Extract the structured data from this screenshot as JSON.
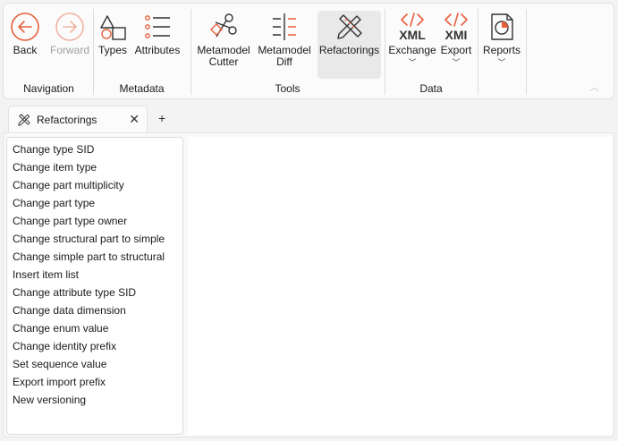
{
  "ribbon": {
    "navigation": {
      "label": "Navigation",
      "back": "Back",
      "forward": "Forward"
    },
    "metadata": {
      "label": "Metadata",
      "types": "Types",
      "attributes": "Attributes"
    },
    "tools": {
      "label": "Tools",
      "metamodel_cutter_1": "Metamodel",
      "metamodel_cutter_2": "Cutter",
      "metamodel_diff_1": "Metamodel",
      "metamodel_diff_2": "Diff",
      "refactorings": "Refactorings"
    },
    "data": {
      "label": "Data",
      "xml_text": "XML",
      "exchange": "Exchange",
      "xmi_text": "XMI",
      "export": "Export"
    },
    "reports": {
      "label": "Reports"
    }
  },
  "tab": {
    "title": "Refactorings",
    "close": "✕",
    "add": "+"
  },
  "refactorings": [
    "Change type SID",
    "Change item type",
    "Change part multiplicity",
    "Change part type",
    "Change part type owner",
    "Change structural part to simple",
    "Change simple part to structural",
    "Insert item list",
    "Change attribute type SID",
    "Change data dimension",
    "Change enum value",
    "Change identity prefix",
    "Set sequence value",
    "Export import prefix",
    "New versioning"
  ],
  "colors": {
    "accent": "#e8603c",
    "text": "#1b1b1b",
    "disabled": "#a0a0a0"
  },
  "icons": {
    "back": "arrow-left-circle-icon",
    "forward": "arrow-right-circle-icon",
    "types": "shapes-icon",
    "attributes": "list-icon",
    "cutter": "scissors-icon",
    "diff": "diff-icon",
    "refactorings": "pencil-ruler-icon",
    "xml": "code-icon",
    "xmi": "code-icon",
    "reports": "report-icon"
  }
}
